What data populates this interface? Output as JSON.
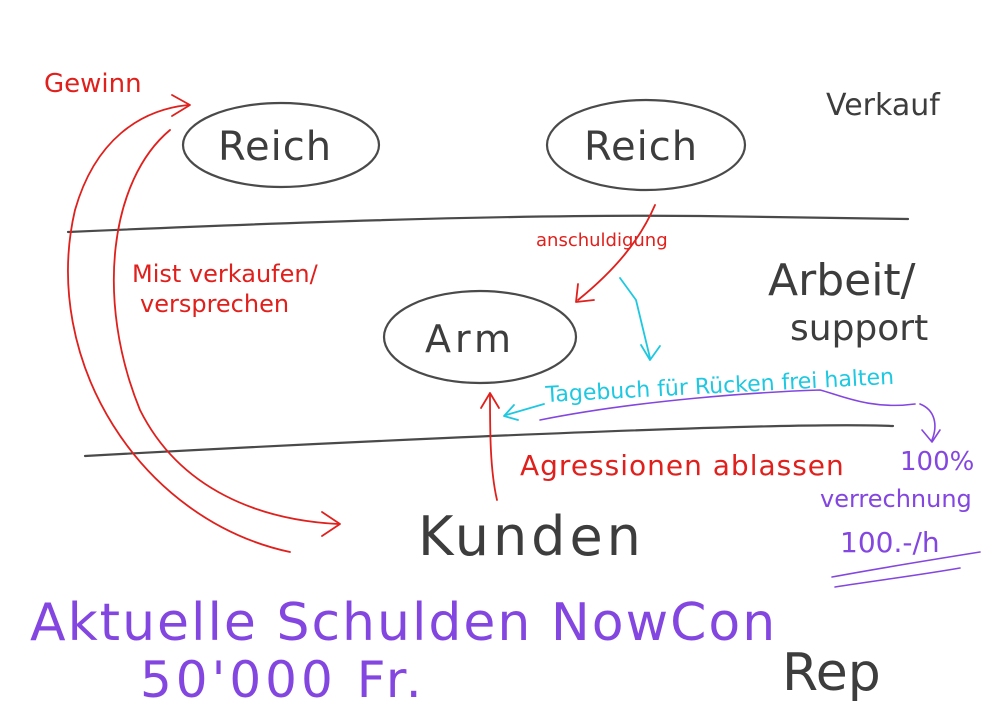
{
  "colors": {
    "ink": "#3d3d3d",
    "red": "#e0201c",
    "cyan": "#1ec8e0",
    "purple": "#8446e0",
    "background": "#ffffff"
  },
  "nodes": {
    "reich_left": "Reich",
    "reich_right": "Reich",
    "arm": "Arm",
    "kunden": "Kunden"
  },
  "section_labels": {
    "verkauf": "Verkauf",
    "arbeit": "Arbeit/",
    "support": "support",
    "rep": "Rep"
  },
  "annotations": {
    "gewinn": "Gewinn",
    "mist_line1": "Mist verkaufen/",
    "mist_line2": "versprechen",
    "anschuldigung": "anschuldigung",
    "agressionen": "Agressionen ablassen",
    "tagebuch": "Tagebuch für Rücken frei halten",
    "prozent": "100%",
    "verrechnung": "verrechnung",
    "rate": "100.-/h"
  },
  "debt": {
    "line1": "Aktuelle Schulden NowCon",
    "line2": "50'000 Fr."
  }
}
